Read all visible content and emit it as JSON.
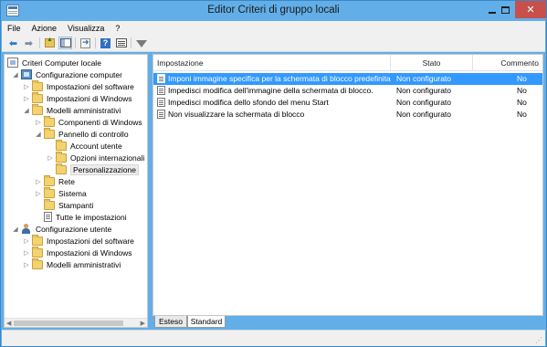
{
  "window": {
    "title": "Editor Criteri di gruppo locali",
    "close_label": "✕"
  },
  "menu": {
    "items": [
      "File",
      "Azione",
      "Visualizza",
      "?"
    ]
  },
  "toolbar": {
    "back_icon": "arrow-back-icon",
    "forward_icon": "arrow-forward-icon",
    "help_label": "?"
  },
  "tree": {
    "items": [
      {
        "label": "Criteri Computer locale",
        "icon": "gpo-icon"
      },
      {
        "label": "Configurazione computer",
        "icon": "computer-icon"
      },
      {
        "label": "Impostazioni del software",
        "icon": "folder-icon"
      },
      {
        "label": "Impostazioni di Windows",
        "icon": "folder-icon"
      },
      {
        "label": "Modelli amministrativi",
        "icon": "folder-icon"
      },
      {
        "label": "Componenti di Windows",
        "icon": "folder-icon"
      },
      {
        "label": "Pannello di controllo",
        "icon": "folder-icon"
      },
      {
        "label": "Account utente",
        "icon": "folder-icon"
      },
      {
        "label": "Opzioni internazionali",
        "icon": "folder-icon"
      },
      {
        "label": "Personalizzazione",
        "icon": "folder-icon"
      },
      {
        "label": "Rete",
        "icon": "folder-icon"
      },
      {
        "label": "Sistema",
        "icon": "folder-icon"
      },
      {
        "label": "Stampanti",
        "icon": "folder-icon"
      },
      {
        "label": "Tutte le impostazioni",
        "icon": "document-icon"
      },
      {
        "label": "Configurazione utente",
        "icon": "user-icon"
      },
      {
        "label": "Impostazioni del software",
        "icon": "folder-icon"
      },
      {
        "label": "Impostazioni di Windows",
        "icon": "folder-icon"
      },
      {
        "label": "Modelli amministrativi",
        "icon": "folder-icon"
      }
    ],
    "selected": "Personalizzazione"
  },
  "list": {
    "columns": [
      "Impostazione",
      "Stato",
      "Commento"
    ],
    "rows": [
      {
        "setting": "Imponi immagine specifica per la schermata di blocco predefinita",
        "state": "Non configurato",
        "comment": "No"
      },
      {
        "setting": "Impedisci modifica dell'immagine della schermata di blocco.",
        "state": "Non configurato",
        "comment": "No"
      },
      {
        "setting": "Impedisci modifica dello sfondo del menu Start",
        "state": "Non configurato",
        "comment": "No"
      },
      {
        "setting": "Non visualizzare la schermata di blocco",
        "state": "Non configurato",
        "comment": "No"
      }
    ],
    "selected_row": 0
  },
  "tabs": {
    "extended": "Esteso",
    "standard": "Standard"
  },
  "colors": {
    "title_bar": "#62aee8",
    "close_button": "#c7504a",
    "selection": "#3399ff"
  }
}
